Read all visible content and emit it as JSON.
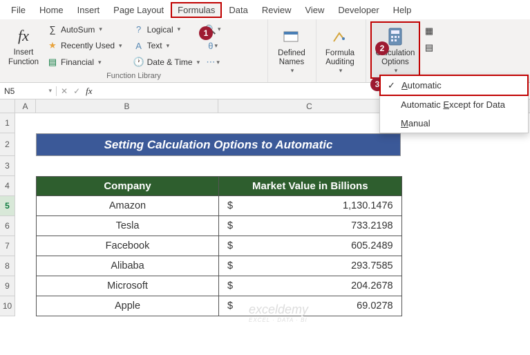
{
  "tabs": {
    "file": "File",
    "home": "Home",
    "insert": "Insert",
    "page_layout": "Page Layout",
    "formulas": "Formulas",
    "data": "Data",
    "review": "Review",
    "view": "View",
    "developer": "Developer",
    "help": "Help"
  },
  "ribbon": {
    "insert_function": "Insert\nFunction",
    "autosum": "AutoSum",
    "recently_used": "Recently Used",
    "financial": "Financial",
    "logical": "Logical",
    "text": "Text",
    "date_time": "Date & Time",
    "function_library": "Function Library",
    "defined_names": "Defined\nNames",
    "formula_auditing": "Formula\nAuditing",
    "calculation_options": "Calculation\nOptions"
  },
  "dropdown": {
    "automatic": "Automatic",
    "automatic_except": "Automatic Except for Data",
    "manual": "Manual"
  },
  "name_box": "N5",
  "fx_label": "fx",
  "columns": {
    "a": "A",
    "b": "B",
    "c": "C"
  },
  "rows": [
    "1",
    "2",
    "3",
    "4",
    "5",
    "6",
    "7",
    "8",
    "9",
    "10"
  ],
  "banner_title": "Setting Calculation Options to Automatic",
  "table": {
    "headers": {
      "company": "Company",
      "market_value": "Market Value in Billions"
    },
    "currency": "$",
    "rows": [
      {
        "name": "Amazon",
        "value": "1,130.1476"
      },
      {
        "name": "Tesla",
        "value": "733.2198"
      },
      {
        "name": "Facebook",
        "value": "605.2489"
      },
      {
        "name": "Alibaba",
        "value": "293.7585"
      },
      {
        "name": "Microsoft",
        "value": "204.2678"
      },
      {
        "name": "Apple",
        "value": "69.0278"
      }
    ]
  },
  "badges": {
    "b1": "1",
    "b2": "2",
    "b3": "3"
  },
  "watermark": {
    "main": "exceldemy",
    "sub": "EXCEL · DATA · BI"
  },
  "chart_data": {
    "type": "table",
    "title": "Setting Calculation Options to Automatic",
    "columns": [
      "Company",
      "Market Value in Billions"
    ],
    "rows": [
      [
        "Amazon",
        1130.1476
      ],
      [
        "Tesla",
        733.2198
      ],
      [
        "Facebook",
        605.2489
      ],
      [
        "Alibaba",
        293.7585
      ],
      [
        "Microsoft",
        204.2678
      ],
      [
        "Apple",
        69.0278
      ]
    ]
  }
}
